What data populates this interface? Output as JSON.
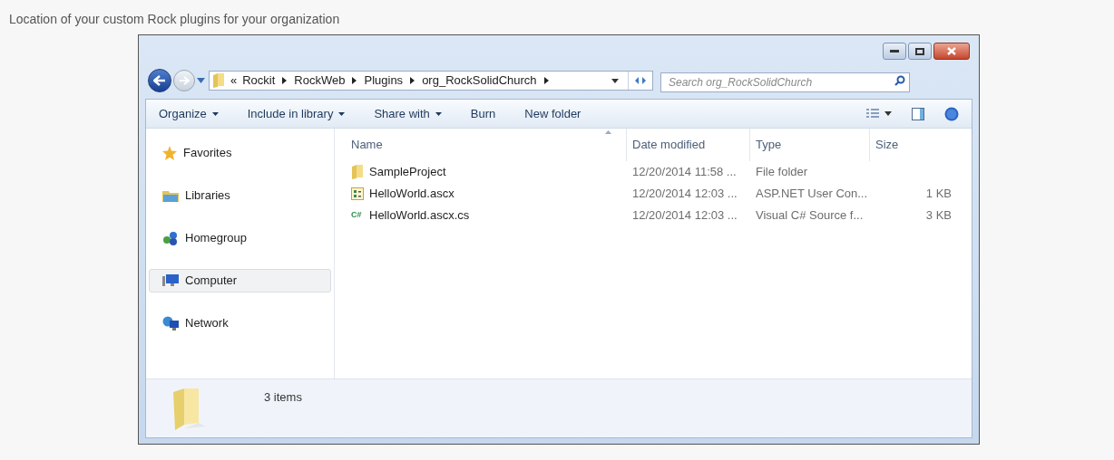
{
  "caption": "Location of your custom Rock plugins for your organization",
  "address": {
    "overflow": "«",
    "breadcrumb": [
      "Rockit",
      "RockWeb",
      "Plugins",
      "org_RockSolidChurch"
    ]
  },
  "search": {
    "placeholder": "Search org_RockSolidChurch"
  },
  "toolbar": [
    {
      "label": "Organize",
      "dropdown": true
    },
    {
      "label": "Include in library",
      "dropdown": true
    },
    {
      "label": "Share with",
      "dropdown": true
    },
    {
      "label": "Burn",
      "dropdown": false
    },
    {
      "label": "New folder",
      "dropdown": false
    }
  ],
  "sidebar": {
    "items": [
      {
        "label": "Favorites",
        "kind": "star",
        "selected": false
      },
      {
        "label": "Libraries",
        "kind": "library",
        "selected": false
      },
      {
        "label": "Homegroup",
        "kind": "homegroup",
        "selected": false
      },
      {
        "label": "Computer",
        "kind": "computer",
        "selected": true
      },
      {
        "label": "Network",
        "kind": "network",
        "selected": false
      }
    ]
  },
  "table": {
    "columns": [
      "Name",
      "Date modified",
      "Type",
      "Size"
    ],
    "rows": [
      {
        "kind": "folder",
        "cells": [
          "SampleProject",
          "12/20/2014 11:58 ...",
          "File folder",
          ""
        ]
      },
      {
        "kind": "ascx",
        "cells": [
          "HelloWorld.ascx",
          "12/20/2014 12:03 ...",
          "ASP.NET User Con...",
          "1 KB"
        ]
      },
      {
        "kind": "cs",
        "icon_text": "C#",
        "cells": [
          "HelloWorld.ascx.cs",
          "12/20/2014 12:03 ...",
          "Visual C# Source f...",
          "3 KB"
        ]
      }
    ]
  },
  "status_bar": {
    "text": "3 items"
  }
}
